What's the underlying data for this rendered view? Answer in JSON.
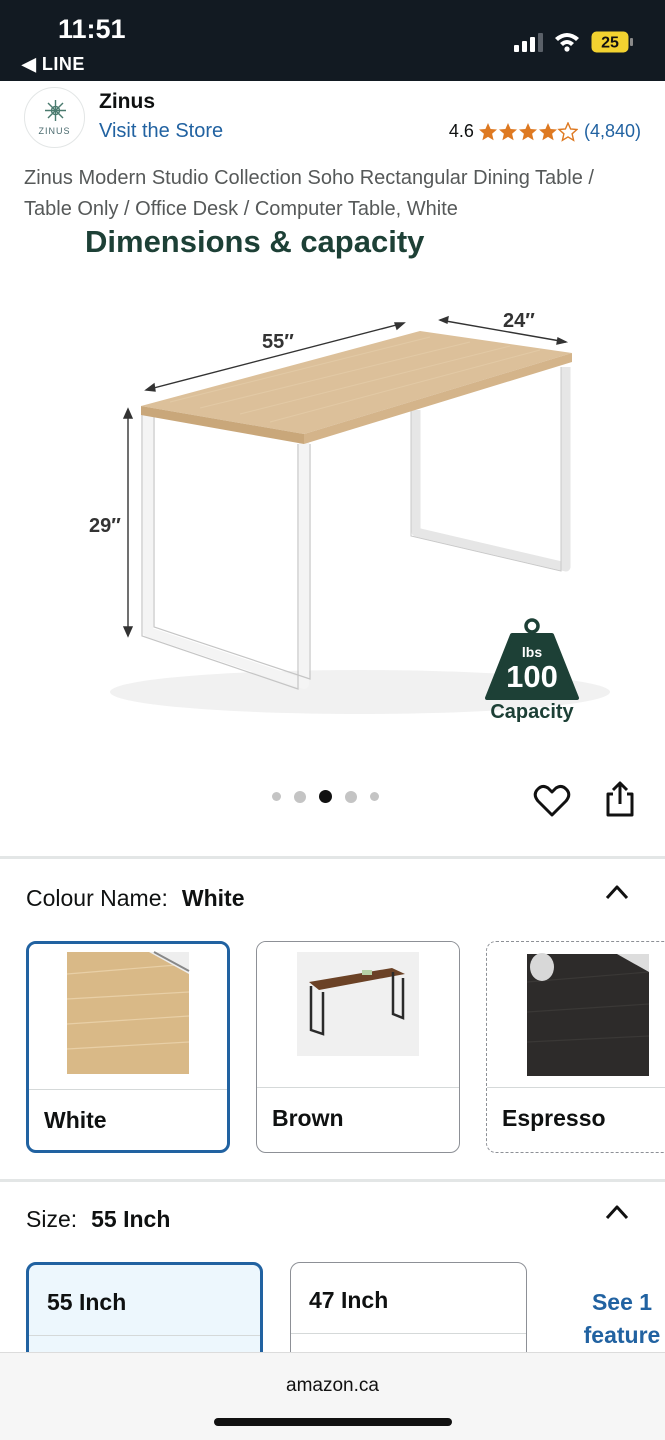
{
  "status_bar": {
    "time": "11:51",
    "back_app": "◀ LINE",
    "battery": "25"
  },
  "brand": {
    "logo_text": "ZINUS",
    "name": "Zinus",
    "visit_store": "Visit the Store"
  },
  "rating": {
    "value": "4.6",
    "stars": 4.6,
    "count": "(4,840)",
    "star_color": "#de7921"
  },
  "product": {
    "title": "Zinus Modern Studio Collection Soho Rectangular Dining Table / Table Only / Office Desk / Computer Table, White"
  },
  "image": {
    "heading": "Dimensions & capacity",
    "width_label": "55″",
    "depth_label": "24″",
    "height_label": "29″",
    "weight_unit": "lbs",
    "weight_value": "100",
    "weight_caption": "Capacity",
    "carousel_count": 5,
    "carousel_active": 3
  },
  "colour": {
    "label": "Colour Name:",
    "selected": "White",
    "options": [
      {
        "label": "White",
        "selected": true
      },
      {
        "label": "Brown",
        "selected": false
      },
      {
        "label": "Espresso",
        "selected": false
      }
    ]
  },
  "size": {
    "label": "Size:",
    "selected": "55 Inch",
    "options": [
      {
        "label": "55 Inch",
        "selected": true
      },
      {
        "label": "47 Inch",
        "selected": false
      }
    ],
    "see_more": "See 1 feature"
  },
  "browser": {
    "url": "amazon.ca"
  },
  "colors": {
    "link": "#2162a1",
    "heading_green": "#1d4036",
    "selected_border": "#2162a1"
  }
}
